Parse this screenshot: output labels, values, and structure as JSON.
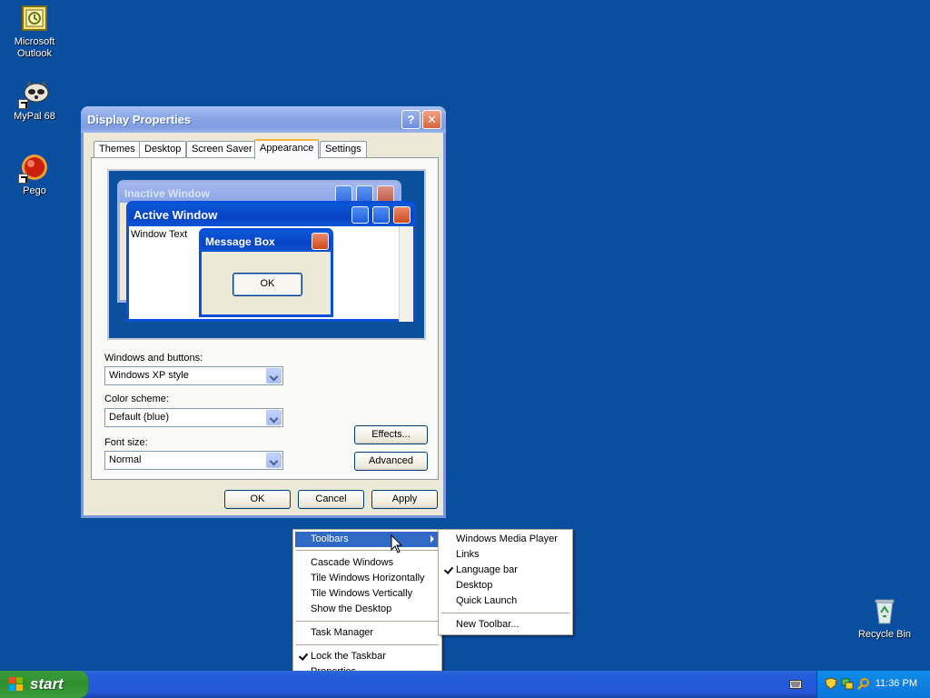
{
  "desktop": {
    "icons": [
      {
        "label": "Microsoft Outlook",
        "icon": "outlook-icon"
      },
      {
        "label": "MyPal 68",
        "icon": "mypal-icon"
      },
      {
        "label": "Pego",
        "icon": "pego-icon"
      },
      {
        "label": "Recycle Bin",
        "icon": "recycle-bin-icon"
      }
    ]
  },
  "window": {
    "title": "Display Properties",
    "help_glyph": "?",
    "close_glyph": "✕",
    "tabs": [
      "Themes",
      "Desktop",
      "Screen Saver",
      "Appearance",
      "Settings"
    ],
    "active_tab": "Appearance",
    "preview": {
      "inactive_title": "Inactive Window",
      "active_title": "Active Window",
      "window_text": "Window Text",
      "message_title": "Message Box",
      "ok_label": "OK"
    },
    "windows_buttons_label": "Windows and buttons:",
    "windows_buttons_value": "Windows XP style",
    "color_scheme_label": "Color scheme:",
    "color_scheme_value": "Default (blue)",
    "font_size_label": "Font size:",
    "font_size_value": "Normal",
    "effects_label": "Effects...",
    "advanced_label": "Advanced",
    "ok_label": "OK",
    "cancel_label": "Cancel",
    "apply_label": "Apply"
  },
  "context_menu": {
    "toolbars": "Toolbars",
    "cascade": "Cascade Windows",
    "tile_h": "Tile Windows Horizontally",
    "tile_v": "Tile Windows Vertically",
    "show_desktop": "Show the Desktop",
    "task_manager": "Task Manager",
    "lock_taskbar": "Lock the Taskbar",
    "properties": "Properties"
  },
  "toolbars_submenu": {
    "wmp": "Windows Media Player",
    "links": "Links",
    "language_bar": "Language bar",
    "desktop": "Desktop",
    "quick_launch": "Quick Launch",
    "new_toolbar": "New Toolbar..."
  },
  "taskbar": {
    "start_label": "start",
    "clock": "11:36 PM"
  },
  "colors": {
    "desktop": "#0a4ea0",
    "menu_highlight": "#316ac5",
    "active_title": "#0a4fd8"
  }
}
